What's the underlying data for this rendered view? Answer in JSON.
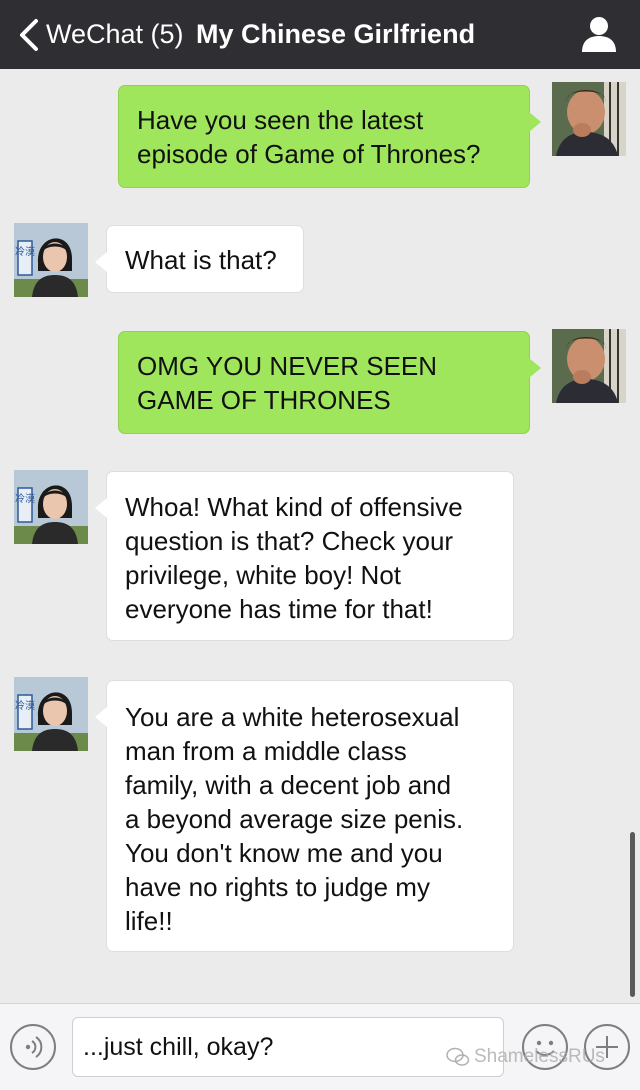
{
  "header": {
    "back_label": "WeChat (5)",
    "title": "My Chinese Girlfriend"
  },
  "messages": [
    {
      "side": "sent",
      "text": "Have you seen the latest\nepisode of Game of Thrones?"
    },
    {
      "side": "received",
      "text": "What is that?"
    },
    {
      "side": "sent",
      "text": "OMG YOU NEVER SEEN\nGAME OF THRONES"
    },
    {
      "side": "received",
      "text": "Whoa! What kind of offensive\nquestion is that? Check your\nprivilege, white boy! Not\neveryone has time for that!"
    },
    {
      "side": "received",
      "text": "You are a white heterosexual\nman from a middle class\nfamily, with a decent job and\na beyond average size penis.\nYou don't know me and you\nhave no rights to judge my\nlife!!"
    }
  ],
  "avatars": {
    "received_badge": "冷漠"
  },
  "input": {
    "value": "...just chill, okay?"
  },
  "watermark": "ShamelessRUs",
  "icons": {
    "back": "chevron-left-icon",
    "profile": "person-icon",
    "voice": "voice-icon",
    "emoji": "smiley-icon",
    "plus": "plus-icon"
  },
  "colors": {
    "header_bg": "#2e2e33",
    "chat_bg": "#ebebeb",
    "sent_bubble": "#9fe65d",
    "received_bubble": "#ffffff"
  }
}
